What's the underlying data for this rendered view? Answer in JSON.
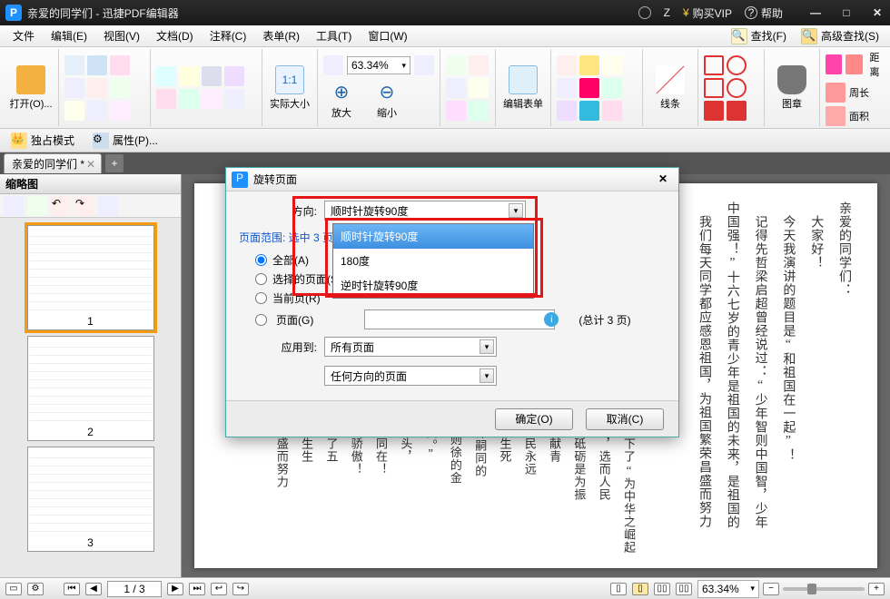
{
  "title": {
    "doc": "亲爱的同学们",
    "app": "迅捷PDF编辑器"
  },
  "titlebar_right": {
    "user": "Z",
    "buy": "购买VIP",
    "help": "帮助"
  },
  "menu": [
    "文件",
    "编辑(E)",
    "视图(V)",
    "文档(D)",
    "注释(C)",
    "表单(R)",
    "工具(T)",
    "窗口(W)"
  ],
  "menu_right": {
    "find": "查找(F)",
    "adv_find": "高级查找(S)"
  },
  "ribbon": {
    "open": "打开(O)...",
    "actual": "实际大小",
    "zoom_in": "放大",
    "zoom_out": "缩小",
    "zoom_value": "63.34%",
    "edit_form": "编辑表单",
    "lines": "线条",
    "stamp": "图章",
    "r1": "距离",
    "r2": "周长",
    "r3": "面积"
  },
  "secondary": {
    "exclusive": "独占模式",
    "properties": "属性(P)..."
  },
  "tab": {
    "name": "亲爱的同学们 *"
  },
  "side": {
    "title": "缩略图",
    "page_nums": [
      "1",
      "2",
      "3"
    ]
  },
  "dialog": {
    "title": "旋转页面",
    "direction_label": "方向:",
    "direction_value": "顺时针旋转90度",
    "options": [
      "顺时针旋转90度",
      "180度",
      "逆时针旋转90度"
    ],
    "range_title": "页面范围: 选中 3 页",
    "radio_all": "全部(A)",
    "radio_sel": "选择的页面(S)",
    "radio_cur": "当前页(R)",
    "radio_pages": "页面(G)",
    "total": "(总计 3 页)",
    "apply_label": "应用到:",
    "apply_value": "所有页面",
    "orient_value": "任何方向的页面",
    "ok": "确定(O)",
    "cancel": "取消(C)"
  },
  "status": {
    "page": "1 / 3",
    "zoom": "63.34%"
  },
  "doc_text_top": "亲爱的同学们：\n　大家好！\n　今天我演讲的题目是“和祖国在一起”！\n　记得先哲梁启超曾经说过：“少年智则中国智，少年\n中国强！”十六七岁的青少年是祖国的未来，是祖国的\n　我们每天同学都应感恩祖国，为祖国繁荣昌盛而努力",
  "doc_text_bottom": "年读书时就立下了“为中华之崛起\n允祖国的昨日，选而人民\n荣利服、寒窗砥砺是为振\n振兴祖国、奉献青\n崛起，祖国人民永远\n然，从容面对生死\n两昆仑”是谭嗣同的\n也之。”是林则徐的金\n“视死忽如归。”\n危急存亡的关头，\n的人民和祖国同在！\n的民族为他们骄傲！\n文明，它经历了五\n它拥有五千年生生\n祖国的繁荣昌盛而努力",
  "chart_data": null
}
